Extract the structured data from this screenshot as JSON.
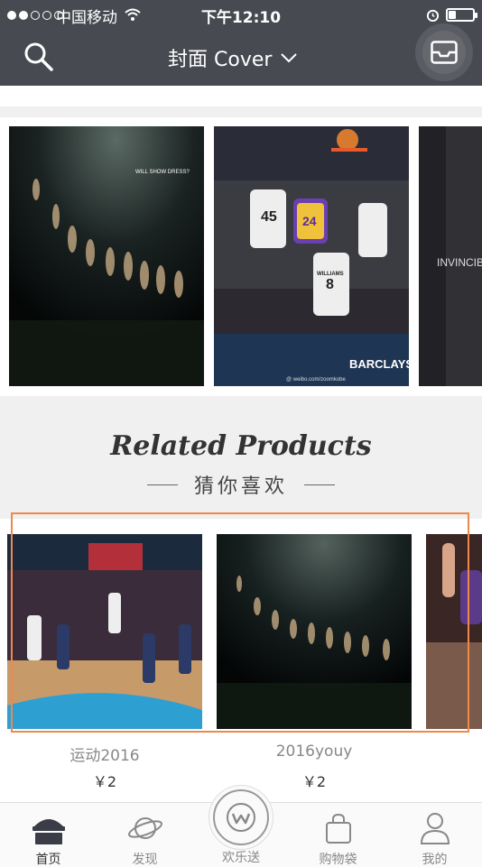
{
  "status_bar": {
    "signal": {
      "filled": 2,
      "empty": 3
    },
    "carrier": "中国移动",
    "time": "下午12:10",
    "battery_level": 0.3
  },
  "nav": {
    "title": "封面 Cover",
    "search_icon": "search-icon",
    "inbox_icon": "inbox-tray-icon"
  },
  "covers": [
    {
      "text": "WILL SHOW DRESS?"
    },
    {
      "text": "BARCLAYS",
      "jerseys": [
        "45",
        "24",
        "8"
      ],
      "jersey_name": "WILLIAMS",
      "caption": "@ weibo.com/zoomkobe"
    },
    {
      "text": "INVINCIBLE"
    }
  ],
  "related": {
    "title": "Related Products",
    "subtitle": "猜你喜欢"
  },
  "products": [
    {
      "name": "运动2016",
      "price": "￥2"
    },
    {
      "name": "2016youy",
      "price": "￥2"
    }
  ],
  "tabbar": {
    "tabs": [
      {
        "label": "首页",
        "icon": "home-icon",
        "active": true
      },
      {
        "label": "发现",
        "icon": "planet-icon",
        "active": false
      },
      {
        "label": "欢乐送",
        "icon": "w-logo-icon",
        "active": false
      },
      {
        "label": "购物袋",
        "icon": "shopping-bag-icon",
        "active": false
      },
      {
        "label": "我的",
        "icon": "user-icon",
        "active": false
      }
    ]
  },
  "colors": {
    "topbar": "#474a51",
    "highlight": "#f0884a",
    "background": "#f0f0f0"
  }
}
